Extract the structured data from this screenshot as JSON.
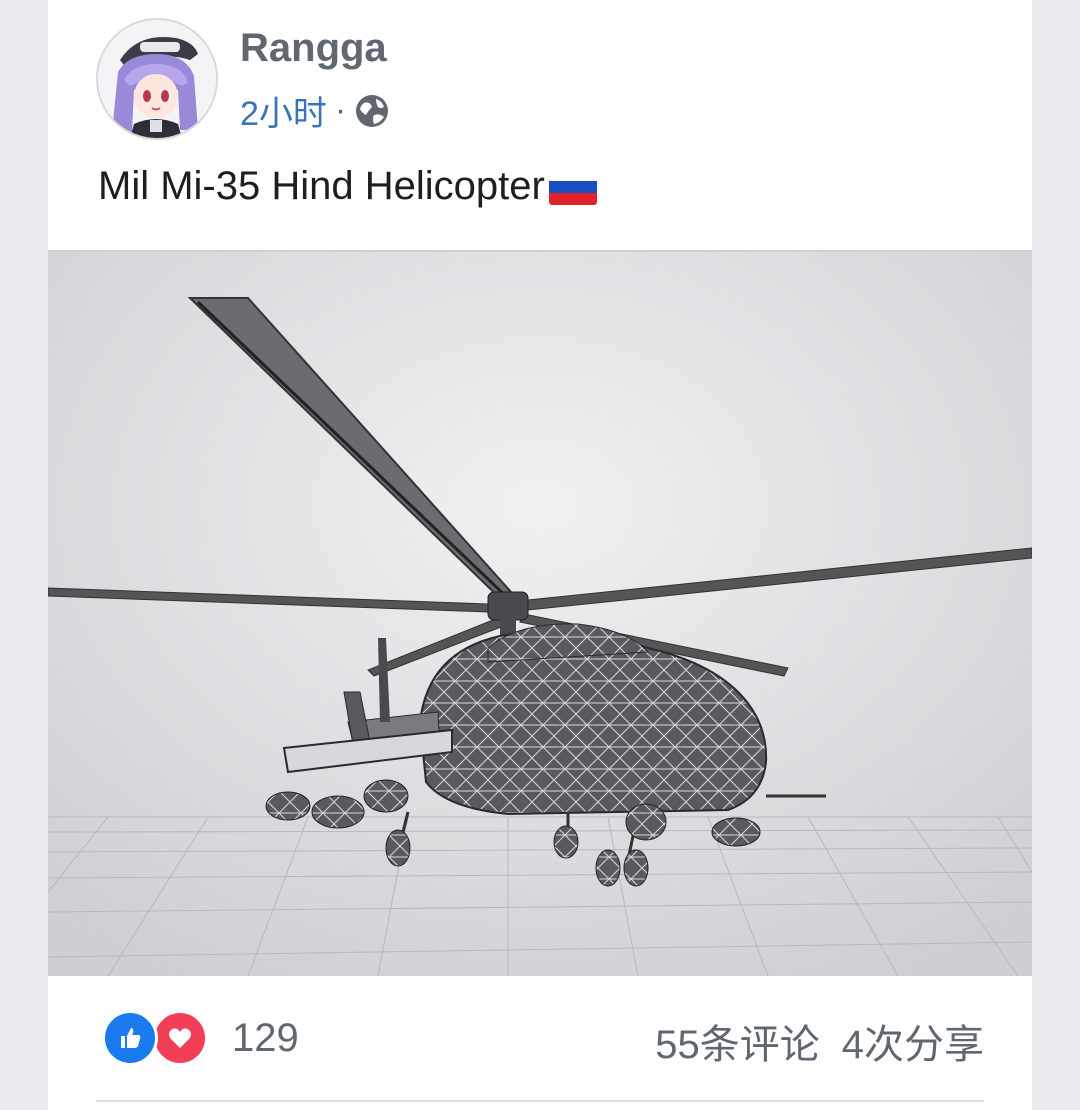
{
  "post": {
    "author": "Rangga",
    "time": "2小时",
    "separator": "·",
    "privacy_icon": "globe-icon",
    "text": "Mil Mi-35 Hind Helicopter",
    "text_emoji": "russia-flag-emoji"
  },
  "media": {
    "type": "3d-wireframe-render-helicopter"
  },
  "footer": {
    "reaction_icons": [
      "like-icon",
      "love-icon"
    ],
    "reaction_count": "129",
    "comments": "55条评论",
    "shares": "4次分享"
  },
  "colors": {
    "link_blue": "#3b73b9",
    "like_blue": "#1a7bf0",
    "love_red": "#f33e58",
    "text_gray": "#606770"
  }
}
